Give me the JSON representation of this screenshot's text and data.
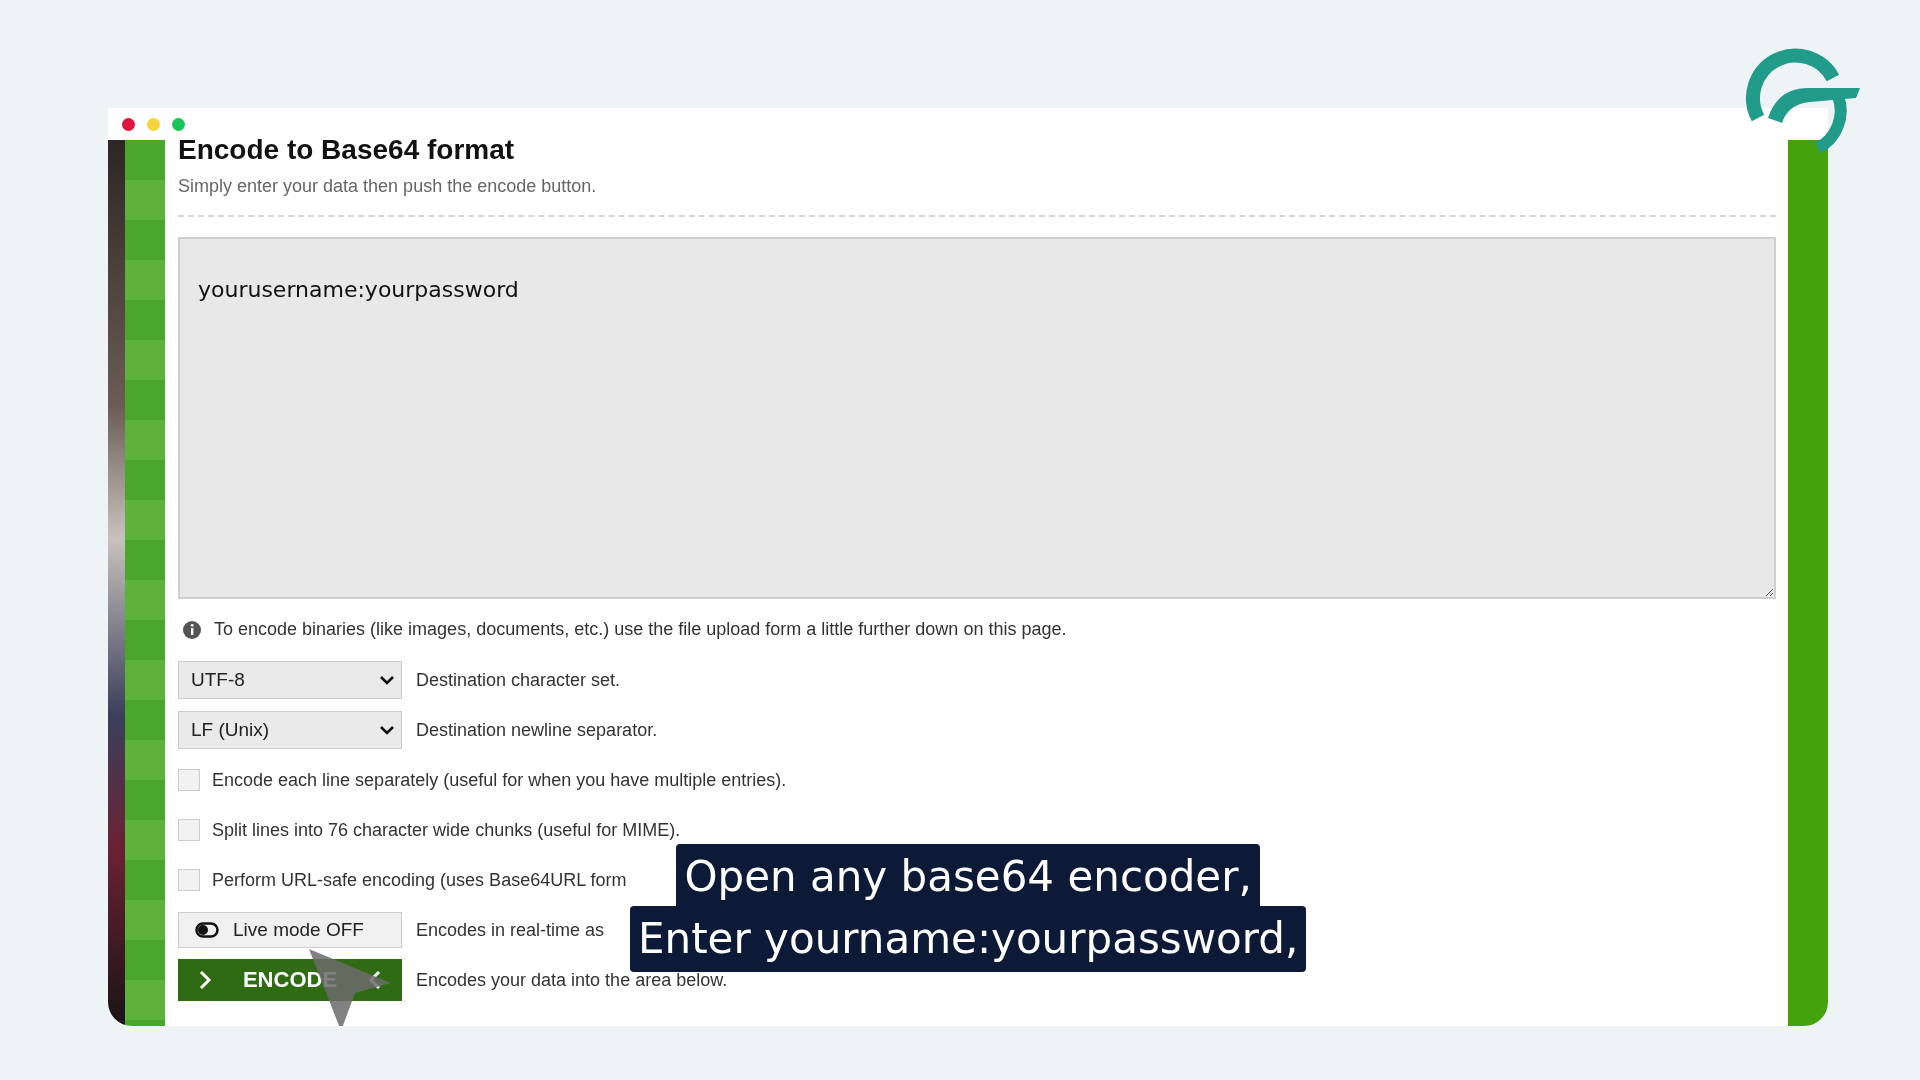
{
  "page": {
    "title": "Encode to Base64 format",
    "subtitle": "Simply enter your data then push the encode button."
  },
  "input": {
    "value": "yourusername:yourpassword"
  },
  "info": "To encode binaries (like images, documents, etc.) use the file upload form a little further down on this page.",
  "selects": [
    {
      "value": "UTF-8",
      "label": "Destination character set."
    },
    {
      "value": "LF (Unix)",
      "label": "Destination newline separator."
    }
  ],
  "options": [
    {
      "label": "Encode each line separately (useful for when you have multiple entries).",
      "checked": false
    },
    {
      "label": "Split lines into 76 character wide chunks (useful for MIME).",
      "checked": false
    },
    {
      "label": "Perform URL-safe encoding (uses Base64URL form",
      "checked": false
    }
  ],
  "live_mode": {
    "label": "Live mode OFF",
    "on": false,
    "description": "Encodes in real-time as"
  },
  "encode": {
    "label": "ENCODE",
    "description": "Encodes your data into the area below."
  },
  "captions": [
    "Open any base64 encoder,",
    "Enter yourname:yourpassword,"
  ]
}
